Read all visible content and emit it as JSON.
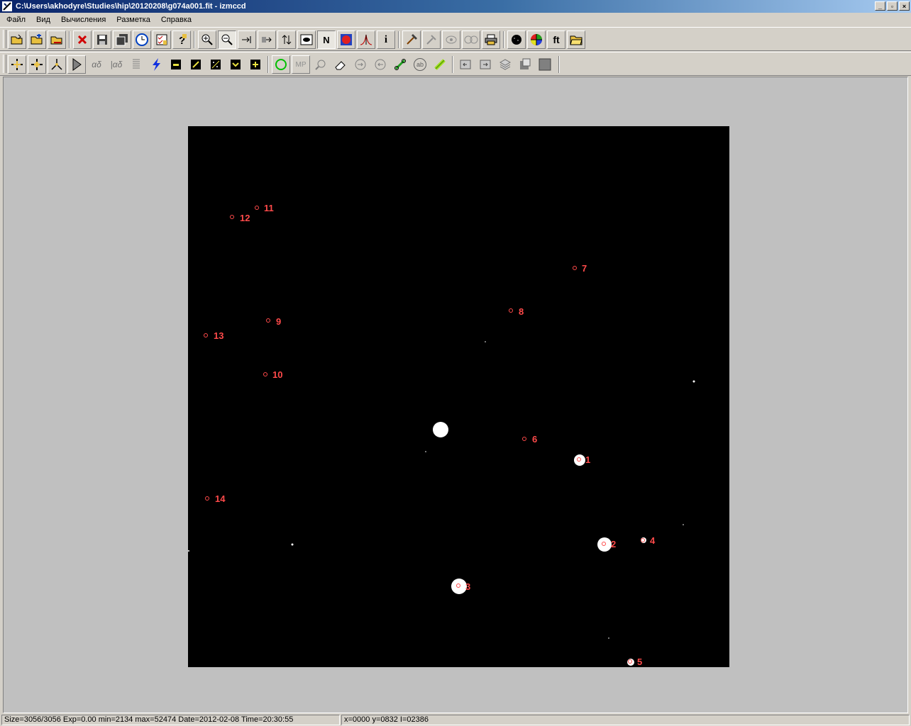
{
  "window": {
    "title": "C:\\Users\\akhodyre\\Studies\\hip\\20120208\\g074a001.fit - izmccd",
    "minimize": "_",
    "restore": "▫",
    "close": "×"
  },
  "menu": [
    "Файл",
    "Вид",
    "Вычисления",
    "Разметка",
    "Справка"
  ],
  "toolbar1": {
    "n_label": "N",
    "info_label": "i",
    "ft_label": "ft"
  },
  "toolbar2": {
    "alpha_delta": "αδ",
    "alpha_delta_alt": "|αδ",
    "mp_label": "MP",
    "ab_label": "ab"
  },
  "colors": {
    "marker": "#ff4a4a",
    "star": "#ffffff",
    "background": "#000000",
    "workspace": "#c0c0c0"
  },
  "stars": [
    {
      "label": "1"
    },
    {
      "label": "2"
    },
    {
      "label": "3"
    },
    {
      "label": "4"
    },
    {
      "label": "5"
    },
    {
      "label": "6"
    },
    {
      "label": "7"
    },
    {
      "label": "8"
    },
    {
      "label": "9"
    },
    {
      "label": "10"
    },
    {
      "label": "11"
    },
    {
      "label": "12"
    },
    {
      "label": "13"
    },
    {
      "label": "14"
    }
  ],
  "status": {
    "info": "Size=3056/3056 Exp=0.00 min=2134 max=52474 Date=2012-02-08 Time=20:30:55",
    "cursor": "x=0000 y=0832 I=02386"
  }
}
